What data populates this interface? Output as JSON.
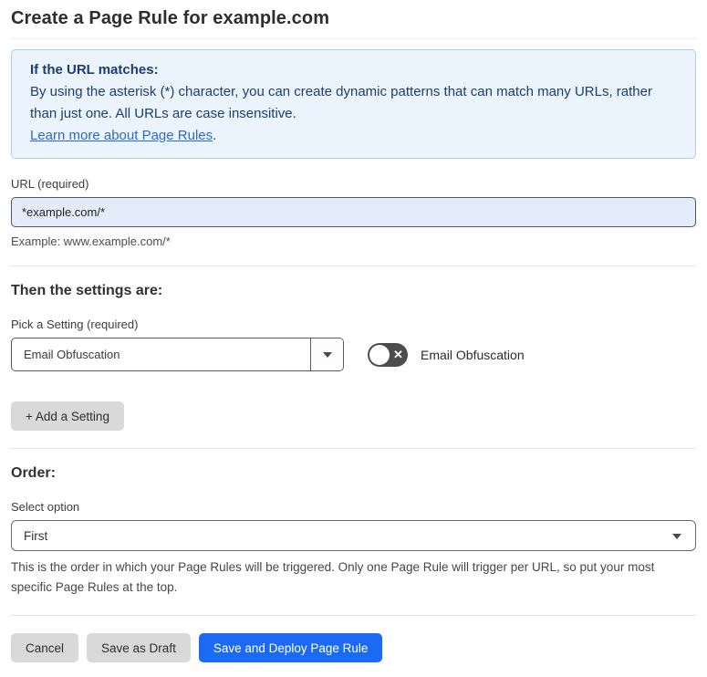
{
  "page": {
    "title": "Create a Page Rule for example.com"
  },
  "info_box": {
    "heading": "If the URL matches:",
    "body": "By using the asterisk (*) character, you can create dynamic patterns that can match many URLs, rather than just one. All URLs are case insensitive.",
    "link_label": "Learn more about Page Rules",
    "link_suffix": "."
  },
  "url_section": {
    "label": "URL (required)",
    "input_value": "*example.com/*",
    "example": "Example: www.example.com/*"
  },
  "settings_section": {
    "heading": "Then the settings are:",
    "pick_label": "Pick a Setting (required)",
    "dropdown_value": "Email Obfuscation",
    "toggle_label": "Email Obfuscation",
    "toggle_state": "off",
    "add_button_label": "+ Add a Setting"
  },
  "order_section": {
    "heading": "Order:",
    "label": "Select option",
    "dropdown_value": "First",
    "help_text": "This is the order in which your Page Rules will be triggered. Only one Page Rule will trigger per URL, so put your most specific Page Rules at the top."
  },
  "footer": {
    "cancel_label": "Cancel",
    "save_draft_label": "Save as Draft",
    "save_deploy_label": "Save and Deploy Page Rule"
  },
  "icons": {
    "toggle_x": "✕"
  },
  "colors": {
    "accent_blue": "#1a6bf2",
    "info_bg": "#ebf4fc",
    "info_border": "#abcfef",
    "info_text": "#1e3c6e",
    "link_blue": "#2e6ac0",
    "input_bg": "#e4ecfa",
    "gray_button": "#d9d9d9",
    "toggle_off": "#4d4d4d"
  }
}
